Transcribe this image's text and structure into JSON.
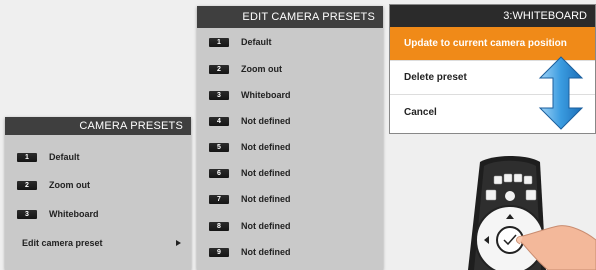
{
  "camera_presets": {
    "title": "CAMERA PRESETS",
    "items": [
      {
        "num": "1",
        "label": "Default"
      },
      {
        "num": "2",
        "label": "Zoom out"
      },
      {
        "num": "3",
        "label": "Whiteboard"
      }
    ],
    "edit_label": "Edit camera preset"
  },
  "edit_camera_presets": {
    "title": "EDIT CAMERA PRESETS",
    "items": [
      {
        "num": "1",
        "label": "Default"
      },
      {
        "num": "2",
        "label": "Zoom out"
      },
      {
        "num": "3",
        "label": "Whiteboard"
      },
      {
        "num": "4",
        "label": "Not defined"
      },
      {
        "num": "5",
        "label": "Not defined"
      },
      {
        "num": "6",
        "label": "Not defined"
      },
      {
        "num": "7",
        "label": "Not defined"
      },
      {
        "num": "8",
        "label": "Not defined"
      },
      {
        "num": "9",
        "label": "Not defined"
      }
    ]
  },
  "preset_menu": {
    "title": "3:WHITEBOARD",
    "items": [
      "Update to current camera position",
      "Delete preset",
      "Cancel"
    ]
  },
  "colors": {
    "accent_orange": "#f08a18",
    "header_dark": "#3f3f3f",
    "arrow_blue": "#2f8fd8"
  }
}
